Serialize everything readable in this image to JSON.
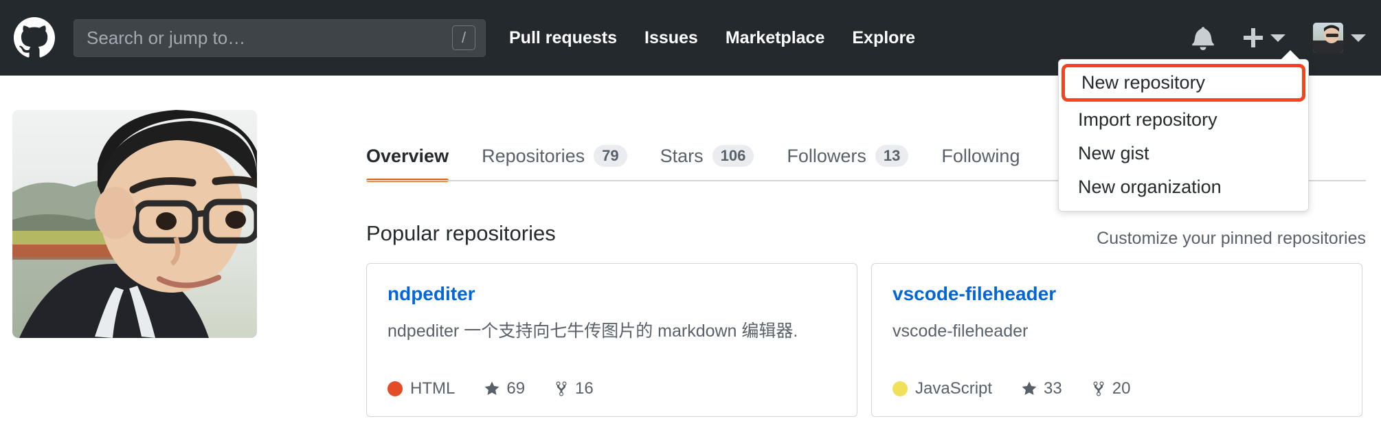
{
  "header": {
    "logo_icon": "github-mark-icon",
    "search": {
      "placeholder": "Search or jump to…",
      "value": "",
      "shortcut_key": "/"
    },
    "nav": [
      {
        "label": "Pull requests"
      },
      {
        "label": "Issues"
      },
      {
        "label": "Marketplace"
      },
      {
        "label": "Explore"
      }
    ],
    "notifications_icon": "bell-icon",
    "create_new_icon": "plus-icon",
    "create_new_caret_icon": "chevron-down-icon",
    "user_caret_icon": "chevron-down-icon",
    "avatar_icon": "user-avatar",
    "background_color": "#24292e"
  },
  "dropdown": {
    "visible": true,
    "items": [
      {
        "label": "New repository",
        "highlighted": true
      },
      {
        "label": "Import repository",
        "highlighted": false
      },
      {
        "label": "New gist",
        "highlighted": false
      },
      {
        "label": "New organization",
        "highlighted": false
      }
    ],
    "highlight_color": "#f4441e"
  },
  "profile": {
    "avatar_icon": "profile-photo",
    "tabs": [
      {
        "label": "Overview",
        "count": null,
        "active": true
      },
      {
        "label": "Repositories",
        "count": "79",
        "active": false
      },
      {
        "label": "Stars",
        "count": "106",
        "active": false
      },
      {
        "label": "Followers",
        "count": "13",
        "active": false
      },
      {
        "label": "Following",
        "count": null,
        "active": false
      }
    ],
    "active_tab_color": "#e36209"
  },
  "main": {
    "section_title": "Popular repositories",
    "customize_link": "Customize your pinned repositories",
    "repositories": [
      {
        "name": "ndpediter",
        "description": "ndpediter 一个支持向七牛传图片的 markdown 编辑器.",
        "language": "HTML",
        "language_color": "#e34c26",
        "stars": "69",
        "forks": "16",
        "star_icon": "star-icon",
        "fork_icon": "fork-icon"
      },
      {
        "name": "vscode-fileheader",
        "description": "vscode-fileheader",
        "language": "JavaScript",
        "language_color": "#f1e05a",
        "stars": "33",
        "forks": "20",
        "star_icon": "star-icon",
        "fork_icon": "fork-icon"
      }
    ]
  }
}
